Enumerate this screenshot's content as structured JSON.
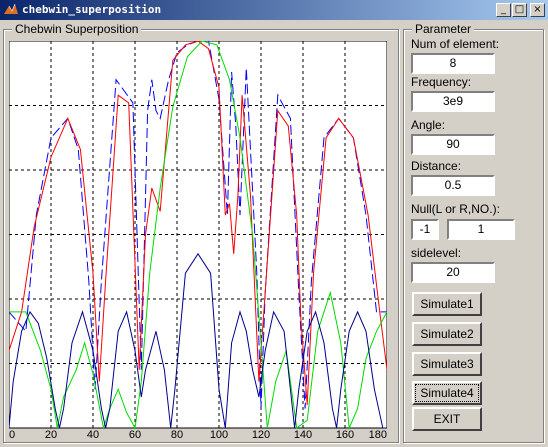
{
  "window": {
    "title": "chebwin_superposition"
  },
  "titlebar_buttons": {
    "minimize": "_",
    "maximize": "□",
    "close": "×"
  },
  "plot_panel": {
    "title": "Chebwin Superposition"
  },
  "params": {
    "title": "Parameter",
    "num_label": "Num of element:",
    "num_value": "8",
    "freq_label": "Frequency:",
    "freq_value": "3e9",
    "angle_label": "Angle:",
    "angle_value": "90",
    "distance_label": "Distance:",
    "distance_value": "0.5",
    "null_label": "Null(L or R,NO.):",
    "null_value1": "-1",
    "null_value2": "1",
    "side_label": "sidelevel:",
    "side_value": "20"
  },
  "buttons": {
    "sim1": "Simulate1",
    "sim2": "Simulate2",
    "sim3": "Simulate3",
    "sim4": "Simulate4",
    "exit": "EXIT"
  },
  "chart_data": {
    "type": "line",
    "xlim": [
      0,
      180
    ],
    "ylim": [
      0,
      1
    ],
    "grid": true,
    "grid_style": "dashed",
    "x_ticks": [
      0,
      20,
      40,
      60,
      80,
      100,
      120,
      140,
      160,
      180
    ],
    "x_tick_labels": [
      "0",
      "20",
      "40",
      "60",
      "80",
      "100",
      "120",
      "140",
      "160",
      "180"
    ],
    "series": [
      {
        "color": "#0000ff",
        "dash": true,
        "points": [
          [
            0,
            0.3
          ],
          [
            8,
            0.25
          ],
          [
            13,
            0.55
          ],
          [
            20,
            0.75
          ],
          [
            28,
            0.8
          ],
          [
            33,
            0.72
          ],
          [
            38,
            0.38
          ],
          [
            41,
            0.1
          ],
          [
            44,
            0.38
          ],
          [
            51,
            0.9
          ],
          [
            59,
            0.84
          ],
          [
            63,
            0.15
          ],
          [
            66,
            0.82
          ],
          [
            68,
            0.9
          ],
          [
            70,
            0.82
          ],
          [
            72,
            0.8
          ],
          [
            76,
            0.9
          ],
          [
            80,
            0.97
          ],
          [
            85,
            0.99
          ],
          [
            90,
            1.0
          ],
          [
            95,
            1.0
          ],
          [
            100,
            0.85
          ],
          [
            104,
            0.55
          ],
          [
            106,
            0.92
          ],
          [
            108,
            0.78
          ],
          [
            110,
            0.55
          ],
          [
            113,
            0.93
          ],
          [
            118,
            0.4
          ],
          [
            120,
            0.05
          ],
          [
            122,
            0.35
          ],
          [
            128,
            0.86
          ],
          [
            134,
            0.8
          ],
          [
            138,
            0.35
          ],
          [
            141,
            0.05
          ],
          [
            144,
            0.38
          ],
          [
            150,
            0.75
          ],
          [
            157,
            0.8
          ],
          [
            164,
            0.75
          ],
          [
            170,
            0.55
          ],
          [
            175,
            0.3
          ],
          [
            180,
            0.3
          ]
        ]
      },
      {
        "color": "#ff0000",
        "dash": false,
        "points": [
          [
            0,
            0.2
          ],
          [
            6,
            0.3
          ],
          [
            12,
            0.52
          ],
          [
            20,
            0.7
          ],
          [
            28,
            0.8
          ],
          [
            34,
            0.72
          ],
          [
            40,
            0.4
          ],
          [
            43,
            0.12
          ],
          [
            46,
            0.38
          ],
          [
            52,
            0.86
          ],
          [
            57,
            0.84
          ],
          [
            62,
            0.15
          ],
          [
            65,
            0.5
          ],
          [
            68,
            0.62
          ],
          [
            72,
            0.56
          ],
          [
            78,
            0.95
          ],
          [
            84,
            0.99
          ],
          [
            90,
            1.0
          ],
          [
            95,
            0.98
          ],
          [
            100,
            0.88
          ],
          [
            103,
            0.55
          ],
          [
            105,
            0.58
          ],
          [
            107,
            0.45
          ],
          [
            109,
            0.6
          ],
          [
            111,
            0.86
          ],
          [
            115,
            0.6
          ],
          [
            119,
            0.12
          ],
          [
            122,
            0.35
          ],
          [
            128,
            0.82
          ],
          [
            133,
            0.78
          ],
          [
            137,
            0.55
          ],
          [
            139,
            0.28
          ],
          [
            142,
            0.06
          ],
          [
            145,
            0.4
          ],
          [
            151,
            0.75
          ],
          [
            157,
            0.8
          ],
          [
            164,
            0.75
          ],
          [
            171,
            0.55
          ],
          [
            177,
            0.28
          ],
          [
            180,
            0.15
          ]
        ]
      },
      {
        "color": "#00dd00",
        "dash": false,
        "points": [
          [
            0,
            0.3
          ],
          [
            8,
            0.3
          ],
          [
            15,
            0.2
          ],
          [
            20,
            0.1
          ],
          [
            23,
            0.0
          ],
          [
            26,
            0.08
          ],
          [
            32,
            0.15
          ],
          [
            36,
            0.22
          ],
          [
            40,
            0.14
          ],
          [
            45,
            0.0
          ],
          [
            48,
            0.05
          ],
          [
            52,
            0.1
          ],
          [
            56,
            0.04
          ],
          [
            60,
            0.0
          ],
          [
            63,
            0.12
          ],
          [
            67,
            0.4
          ],
          [
            72,
            0.62
          ],
          [
            78,
            0.83
          ],
          [
            85,
            0.96
          ],
          [
            92,
            1.0
          ],
          [
            99,
            0.99
          ],
          [
            105,
            0.9
          ],
          [
            110,
            0.75
          ],
          [
            116,
            0.5
          ],
          [
            120,
            0.22
          ],
          [
            123,
            0.0
          ],
          [
            127,
            0.12
          ],
          [
            132,
            0.2
          ],
          [
            137,
            0.0
          ],
          [
            142,
            0.02
          ],
          [
            147,
            0.25
          ],
          [
            153,
            0.35
          ],
          [
            158,
            0.22
          ],
          [
            162,
            0.0
          ],
          [
            166,
            0.05
          ],
          [
            170,
            0.18
          ],
          [
            175,
            0.25
          ],
          [
            180,
            0.3
          ]
        ]
      },
      {
        "color": "#00008b",
        "dash": false,
        "points": [
          [
            0,
            0.0
          ],
          [
            2,
            0.12
          ],
          [
            6,
            0.25
          ],
          [
            10,
            0.3
          ],
          [
            14,
            0.27
          ],
          [
            18,
            0.18
          ],
          [
            22,
            0.05
          ],
          [
            24,
            0.0
          ],
          [
            26,
            0.05
          ],
          [
            30,
            0.22
          ],
          [
            35,
            0.3
          ],
          [
            40,
            0.2
          ],
          [
            44,
            0.05
          ],
          [
            46,
            0.0
          ],
          [
            48,
            0.05
          ],
          [
            52,
            0.25
          ],
          [
            56,
            0.3
          ],
          [
            60,
            0.2
          ],
          [
            63,
            0.08
          ],
          [
            65,
            0.15
          ],
          [
            70,
            0.25
          ],
          [
            74,
            0.15
          ],
          [
            77,
            0.0
          ],
          [
            79,
            0.1
          ],
          [
            84,
            0.4
          ],
          [
            90,
            0.45
          ],
          [
            96,
            0.4
          ],
          [
            100,
            0.1
          ],
          [
            103,
            0.0
          ],
          [
            106,
            0.22
          ],
          [
            110,
            0.3
          ],
          [
            113,
            0.25
          ],
          [
            116,
            0.15
          ],
          [
            119,
            0.08
          ],
          [
            122,
            0.2
          ],
          [
            126,
            0.3
          ],
          [
            131,
            0.25
          ],
          [
            134,
            0.1
          ],
          [
            136,
            0.0
          ],
          [
            138,
            0.1
          ],
          [
            142,
            0.25
          ],
          [
            146,
            0.3
          ],
          [
            150,
            0.22
          ],
          [
            154,
            0.05
          ],
          [
            156,
            0.0
          ],
          [
            158,
            0.1
          ],
          [
            162,
            0.25
          ],
          [
            166,
            0.3
          ],
          [
            170,
            0.25
          ],
          [
            174,
            0.1
          ],
          [
            178,
            0.0
          ],
          [
            180,
            0.0
          ]
        ]
      }
    ]
  }
}
